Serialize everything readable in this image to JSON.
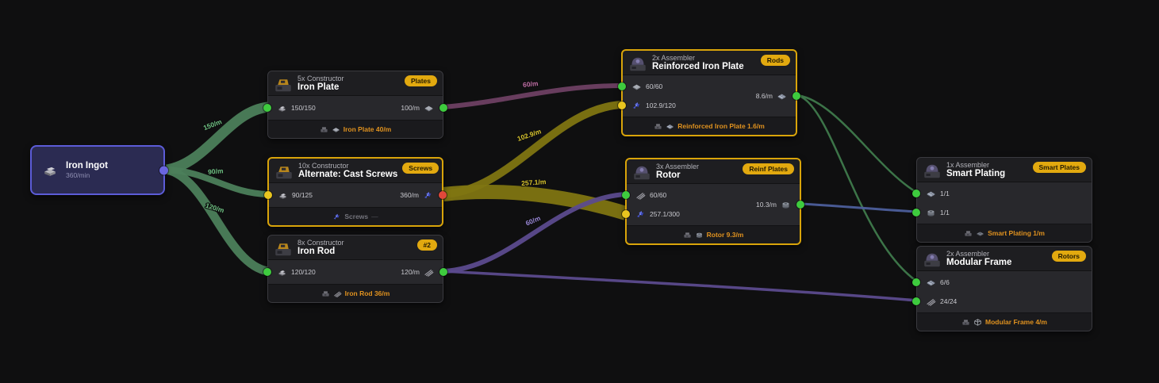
{
  "app": {
    "view": "production-graph-canvas"
  },
  "palette": {
    "background": "#0f0f10",
    "node_header_bg": "#1e1e21",
    "node_body_bg": "#28282c",
    "node_footer_bg": "#1a1a1d",
    "node_border": "#3a3a3f",
    "selected_node_border": "#d9a40a",
    "resource_node_bg": "#2b2b52",
    "resource_node_border": "#5c5cd8",
    "badge_bg": "#e2a90f",
    "footer_rate_text": "#e0921f",
    "port_green": "#3ecb3e",
    "port_yellow": "#e8c51f",
    "port_red": "#e0483a",
    "port_blue": "#6a66e0",
    "edge_green": "#4c7f5b",
    "edge_olive": "#7f7512",
    "edge_mauve": "#6e4063",
    "edge_purple": "#5c4b8e",
    "edge_slate": "#4d5f9c"
  },
  "icons": {
    "iron-ingot-icon": "stack of gray iron ingots",
    "iron-plate-icon": "flat gray plate",
    "reinforced-plate-icon": "bluish reinforced iron plate",
    "screw-icon": "blue screws cluster",
    "iron-rod-icon": "diagonal gray rods",
    "rotor-icon": "gray rotor cylinder",
    "modular-frame-icon": "wireframe cube frame",
    "smart-plating-icon": "dark smart plating plate",
    "constructor-icon": "constructor machine building",
    "assembler-icon": "assembler machine building",
    "machine-mini-icon": "small machine building"
  },
  "nodes": {
    "iron_ingot": {
      "title": "Iron Ingot",
      "rate": "360/min"
    },
    "iron_plate": {
      "machine": "5x Constructor",
      "title": "Iron Plate",
      "badge": "Plates",
      "inputs": [
        {
          "qty": "150/150",
          "item": "iron-ingot"
        }
      ],
      "output": {
        "qty": "100/m",
        "item": "iron-plate"
      },
      "footer": "Iron Plate 40/m"
    },
    "cast_screws": {
      "machine": "10x Constructor",
      "title": "Alternate: Cast Screws",
      "badge": "Screws",
      "inputs": [
        {
          "qty": "90/125",
          "item": "iron-ingot"
        }
      ],
      "output": {
        "qty": "360/m",
        "item": "screw"
      },
      "footer": "Screws",
      "footer_dash": "—"
    },
    "iron_rod": {
      "machine": "8x Constructor",
      "title": "Iron Rod",
      "badge": "#2",
      "inputs": [
        {
          "qty": "120/120",
          "item": "iron-ingot"
        }
      ],
      "output": {
        "qty": "120/m",
        "item": "iron-rod"
      },
      "footer": "Iron Rod 36/m"
    },
    "reinforced_iron_plate": {
      "machine": "2x Assembler",
      "title": "Reinforced Iron Plate",
      "badge": "Rods",
      "inputs": [
        {
          "qty": "60/60",
          "item": "iron-plate"
        },
        {
          "qty": "102.9/120",
          "item": "screw"
        }
      ],
      "output": {
        "qty": "8.6/m",
        "item": "reinforced-plate"
      },
      "footer": "Reinforced Iron Plate 1.6/m"
    },
    "rotor": {
      "machine": "3x Assembler",
      "title": "Rotor",
      "badge": "Reinf Plates",
      "inputs": [
        {
          "qty": "60/60",
          "item": "iron-rod"
        },
        {
          "qty": "257.1/300",
          "item": "screw"
        }
      ],
      "output": {
        "qty": "10.3/m",
        "item": "rotor"
      },
      "footer": "Rotor 9.3/m"
    },
    "smart_plating": {
      "machine": "1x Assembler",
      "title": "Smart Plating",
      "badge": "Smart Plates",
      "inputs": [
        {
          "qty": "1/1",
          "item": "reinforced-plate"
        },
        {
          "qty": "1/1",
          "item": "rotor"
        }
      ],
      "footer": "Smart Plating 1/m"
    },
    "modular_frame": {
      "machine": "2x Assembler",
      "title": "Modular Frame",
      "badge": "Rotors",
      "inputs": [
        {
          "qty": "6/6",
          "item": "reinforced-plate"
        },
        {
          "qty": "24/24",
          "item": "iron-rod"
        }
      ],
      "footer": "Modular Frame 4/m"
    }
  },
  "edges": {
    "ingot_to_iron_plate": {
      "label": "150/m"
    },
    "ingot_to_cast_screws": {
      "label": "90/m"
    },
    "ingot_to_iron_rod": {
      "label": "120/m"
    },
    "iron_plate_to_reinforced_iron_plate": {
      "label": "60/m"
    },
    "cast_screws_to_reinforced_iron_plate": {
      "label": "102.9/m"
    },
    "cast_screws_to_rotor": {
      "label": "257.1/m"
    },
    "iron_rod_to_rotor": {
      "label": "60/m"
    }
  }
}
